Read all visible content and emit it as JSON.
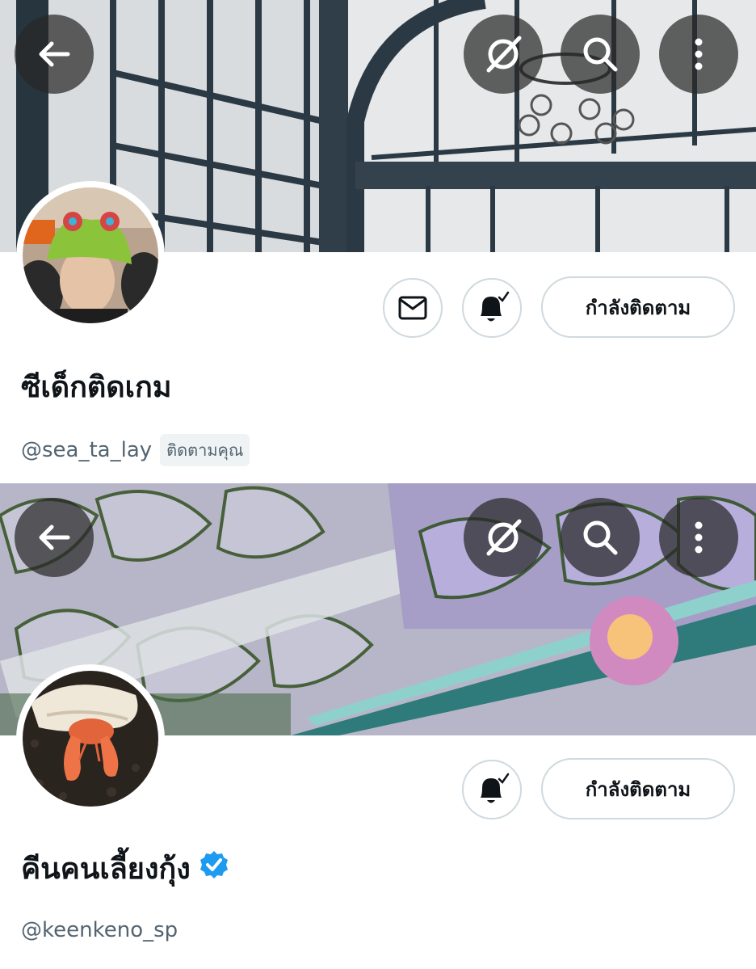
{
  "profiles": [
    {
      "display_name": "ซีเด็กติดเกม",
      "handle": "@sea_ta_lay",
      "follows_you_label": "ติดตามคุณ",
      "follow_button_label": "กำลังติดตาม",
      "verified": false,
      "banner_icons": [
        "back-arrow-icon",
        "grok-icon",
        "search-icon",
        "more-vertical-icon"
      ],
      "action_icons": [
        "envelope-icon",
        "bell-subscribed-icon"
      ]
    },
    {
      "display_name": "คีนคนเลี้ยงกุ้ง",
      "handle": "@keenkeno_sp",
      "follow_button_label": "กำลังติดตาม",
      "verified": true,
      "banner_icons": [
        "back-arrow-icon",
        "grok-icon",
        "search-icon",
        "more-vertical-icon"
      ],
      "action_icons": [
        "bell-subscribed-icon"
      ]
    }
  ],
  "colors": {
    "verified_badge": "#1d9bf0",
    "handle_text": "#536471",
    "button_border": "#cfd9de",
    "overlay_button": "#282828"
  }
}
